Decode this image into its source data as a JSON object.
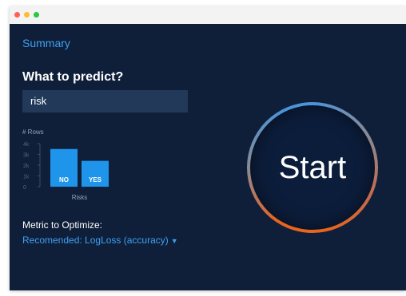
{
  "header": {
    "title": "Summary"
  },
  "predict": {
    "question": "What to predict?",
    "value": "risk"
  },
  "colors": {
    "background": "#0f1f3a",
    "accent": "#3ea0f0",
    "field": "#22395a",
    "bar": "#1e95ea",
    "ring_start": "#4a94d8",
    "ring_end": "#e9641f"
  },
  "chart_data": {
    "type": "bar",
    "ylabel": "# Rows",
    "xlabel": "Risks",
    "categories": [
      "NO",
      "YES"
    ],
    "values": [
      3500,
      2400
    ],
    "yticks": [
      "4k",
      "3k",
      "2k",
      "1k",
      "0"
    ],
    "ylim": [
      0,
      4000
    ],
    "grid": false
  },
  "metric": {
    "label": "Metric to Optimize:",
    "value": "Recomended: LogLoss (accuracy)",
    "caret_icon": "caret-down-icon"
  },
  "start": {
    "label": "Start"
  }
}
